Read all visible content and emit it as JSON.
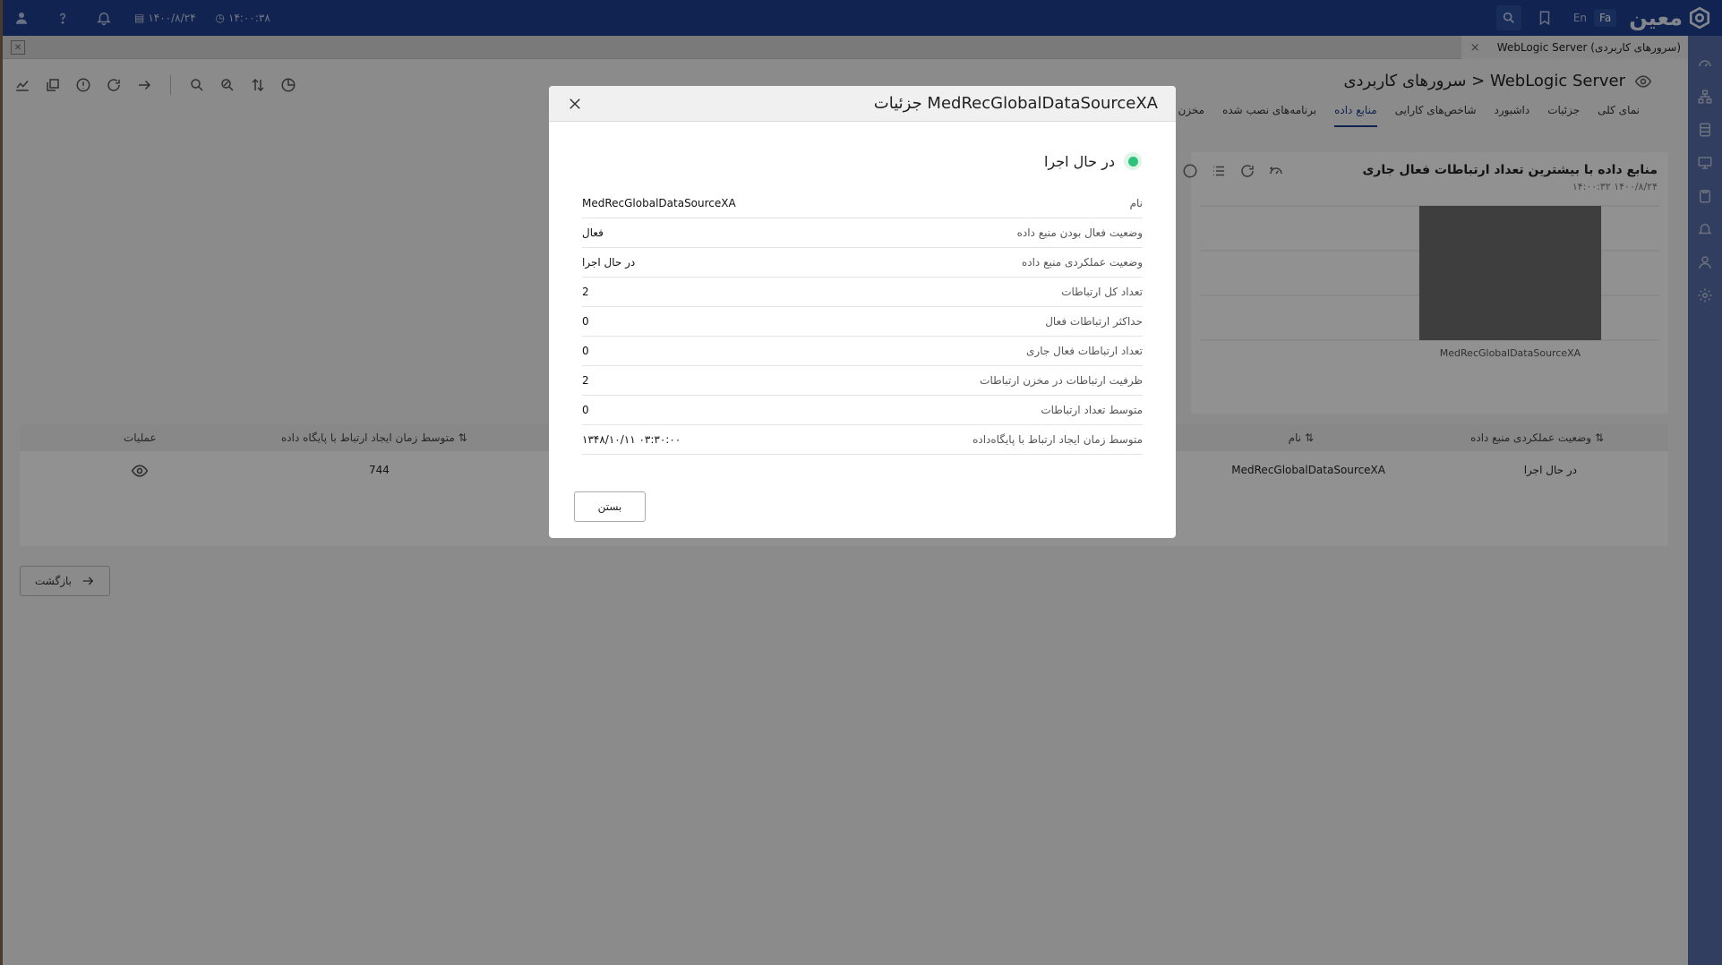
{
  "topbar": {
    "time": "۱۴:۰۰:۳۸",
    "date": "۱۴۰۰/۸/۲۴",
    "lang_en": "En",
    "lang_fa": "Fa",
    "logo_text": "معین"
  },
  "tab": {
    "label": "WebLogic Server (سرورهای کاربردی)",
    "close": "×"
  },
  "page": {
    "title": "سرورهای کاربردی > WebLogic Server",
    "subtabs": [
      "نمای کلی",
      "جزئیات",
      "داشبورد",
      "شاخص‌های کارایی",
      "منابع داده",
      "برنامه‌های نصب شده",
      "مخزن Thread"
    ],
    "active_subtab": "منابع داده"
  },
  "chart_card": {
    "title": "منابع داده با بیشترین تعداد ارتباطات فعال جاری",
    "time": "۱۴:۰۰:۳۲   ۱۴۰۰/۸/۲۴"
  },
  "chart_data": {
    "type": "bar",
    "categories": [
      "MedRecGlobalDataSourceXA"
    ],
    "values": [
      0
    ],
    "title": "منابع داده با بیشترین تعداد ارتباطات فعال جاری",
    "bar_color": "#6e6e6e"
  },
  "table": {
    "headers": {
      "status": "وضعیت عملکردی منبع داده",
      "name": "نام",
      "avg_time": "متوسط زمان ایجاد ارتباط با پایگاه داده",
      "actions": "عملیات"
    },
    "rows": [
      {
        "status": "در حال اجرا",
        "name": "MedRecGlobalDataSourceXA",
        "avg_time": "744"
      }
    ]
  },
  "back_button": "بازگشت",
  "modal": {
    "title": "جزئیات MedRecGlobalDataSourceXA",
    "status": "در حال اجرا",
    "status_color": "#2bc37a",
    "close_button": "بستن",
    "rows": [
      {
        "label": "نام",
        "value": "MedRecGlobalDataSourceXA"
      },
      {
        "label": "وضعیت فعال بودن منبع داده",
        "value": "فعال"
      },
      {
        "label": "وضعیت عملکردی منبع داده",
        "value": "در حال اجرا"
      },
      {
        "label": "تعداد کل ارتباطات",
        "value": "2"
      },
      {
        "label": "حداکثر ارتباطات فعال",
        "value": "0"
      },
      {
        "label": "تعداد ارتباطات فعال جاری",
        "value": "0"
      },
      {
        "label": "ظرفیت ارتباطات در مخزن ارتباطات",
        "value": "2"
      },
      {
        "label": "متوسط تعداد ارتباطات",
        "value": "0"
      },
      {
        "label": "متوسط زمان ایجاد ارتباط با پایگاه‌داده",
        "value": "۱۳۴۸/۱۰/۱۱ ۰۳:۳۰:۰۰"
      }
    ]
  }
}
